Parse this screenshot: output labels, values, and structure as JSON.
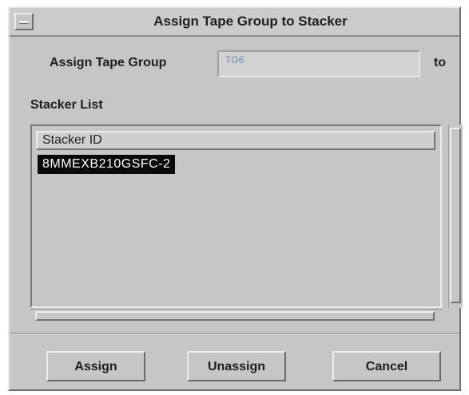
{
  "window": {
    "title": "Assign Tape Group to Stacker"
  },
  "assign_row": {
    "label": "Assign Tape Group",
    "tape_group_value": "TG6",
    "to_label": "to"
  },
  "stacker_list": {
    "label": "Stacker List",
    "column_header": "Stacker ID",
    "rows": [
      "8MMEXB210GSFC-2"
    ],
    "selected_index": 0
  },
  "buttons": {
    "assign": "Assign",
    "unassign": "Unassign",
    "cancel": "Cancel"
  }
}
